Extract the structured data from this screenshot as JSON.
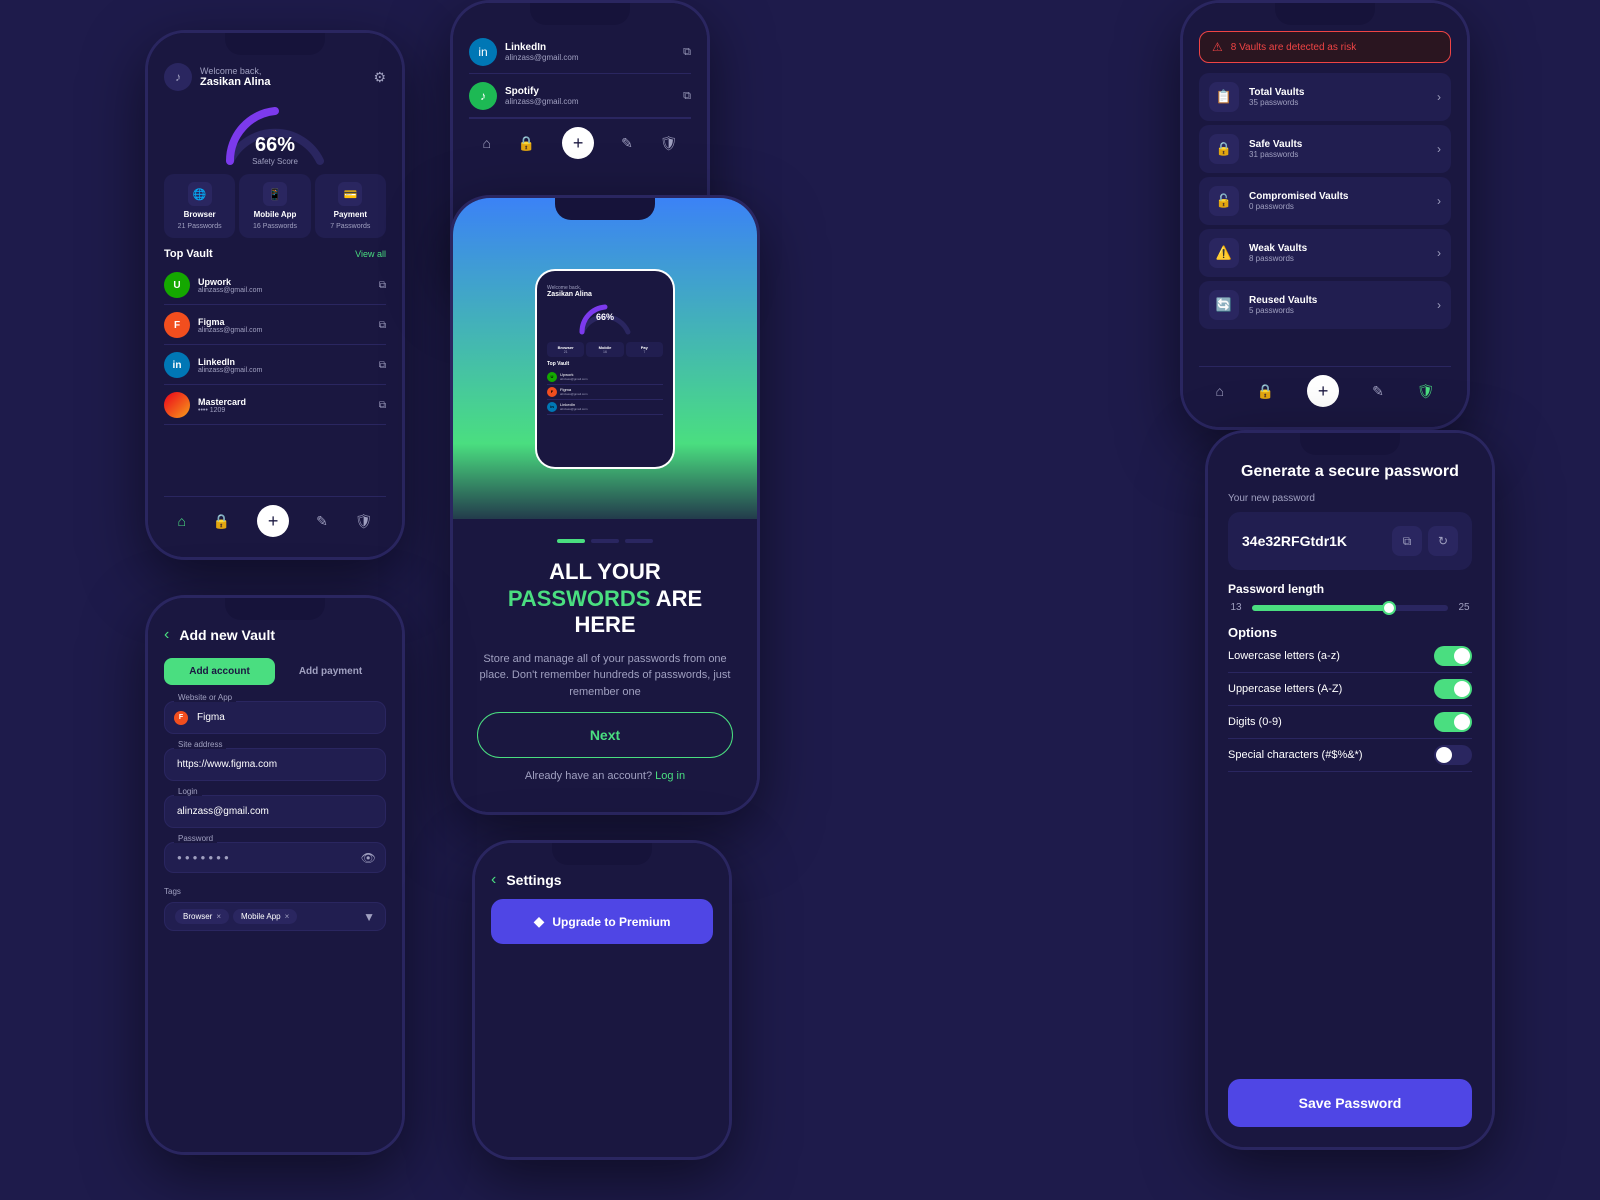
{
  "app": {
    "background": "#1e1b4b"
  },
  "phone_main": {
    "welcome": "Welcome back,",
    "user_name": "Zasikan Alina",
    "safety_score_percent": "66%",
    "safety_score_label": "Safety Score",
    "categories": [
      {
        "name": "Browser",
        "count": "21 Passwords",
        "icon": "🌐"
      },
      {
        "name": "Mobile App",
        "count": "16 Passwords",
        "icon": "📱"
      },
      {
        "name": "Payment",
        "count": "7 Passwords",
        "icon": "💳"
      }
    ],
    "top_vault_title": "Top Vault",
    "view_all": "View all",
    "vaults": [
      {
        "name": "Upwork",
        "email": "alinzass@gmail.com",
        "logo": "U",
        "logo_class": "logo-upwork"
      },
      {
        "name": "Figma",
        "email": "alinzass@gmail.com",
        "logo": "F",
        "logo_class": "logo-figma"
      },
      {
        "name": "LinkedIn",
        "email": "alinzass@gmail.com",
        "logo": "in",
        "logo_class": "logo-linkedin"
      },
      {
        "name": "Mastercard",
        "email": "•••• 1209",
        "logo": "",
        "logo_class": "logo-mastercard"
      }
    ]
  },
  "phone_vault": {
    "vaults": [
      {
        "name": "LinkedIn",
        "email": "alinzass@gmail.com",
        "logo": "in",
        "logo_class": "logo-linkedin"
      },
      {
        "name": "Spotify",
        "email": "alinzass@gmail.com",
        "logo": "♪",
        "logo_class": "logo-spotify"
      }
    ]
  },
  "phone_onboard": {
    "title_line1": "ALL YOUR",
    "title_green": "PASSWORDS",
    "title_line2": "ARE HERE",
    "description": "Store and manage all of your passwords from one place. Don't remember hundreds of passwords, just remember one",
    "next_btn": "Next",
    "already_account": "Already have an account?",
    "login_link": "Log in"
  },
  "phone_security": {
    "risk_text": "8 Vaults are detected as risk",
    "items": [
      {
        "name": "Total Vaults",
        "count": "35 passwords",
        "icon": "📋"
      },
      {
        "name": "Safe Vaults",
        "count": "31 passwords",
        "icon": "🔒"
      },
      {
        "name": "Compromised Vaults",
        "count": "0 passwords",
        "icon": "🔓"
      },
      {
        "name": "Weak Vaults",
        "count": "8 passwords",
        "icon": "⚠️"
      },
      {
        "name": "Reused Vaults",
        "count": "5 passwords",
        "icon": "🔄"
      }
    ]
  },
  "phone_add": {
    "back": "‹",
    "title": "Add new Vault",
    "tab_account": "Add account",
    "tab_payment": "Add payment",
    "fields": {
      "website_label": "Website or App",
      "website_value": "Figma",
      "site_label": "Site address",
      "site_value": "https://www.figma.com",
      "login_label": "Login",
      "login_value": "alinzass@gmail.com",
      "password_label": "Password",
      "password_value": "●●●●●●●"
    },
    "tags_label": "Tags",
    "tags": [
      "Browser  ×",
      "Mobile App  ×"
    ]
  },
  "phone_settings": {
    "back": "‹",
    "title": "Settings",
    "upgrade_btn": "Upgrade to Premium",
    "upgrade_icon": "◆"
  },
  "phone_gen": {
    "title": "Generate a secure password",
    "new_pw_label": "Your new password",
    "password": "34e32RFGtdr1K",
    "length_label": "Password length",
    "length_min": "13",
    "length_max": "25",
    "options_title": "Options",
    "options": [
      {
        "label": "Lowercase letters (a-z)",
        "on": true
      },
      {
        "label": "Uppercase letters (A-Z)",
        "on": true
      },
      {
        "label": "Digits (0-9)",
        "on": true
      },
      {
        "label": "Special characters (#$%&*)",
        "on": false
      }
    ],
    "save_btn": "Save Password"
  }
}
